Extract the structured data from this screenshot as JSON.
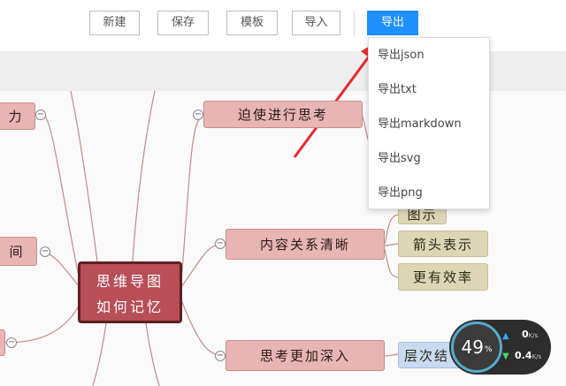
{
  "toolbar": {
    "new_label": "新建",
    "save_label": "保存",
    "template_label": "模板",
    "import_label": "导入",
    "export_label": "导出",
    "accent_color": "#1e90ff"
  },
  "export_menu": {
    "items": [
      "导出json",
      "导出txt",
      "导出markdown",
      "导出svg",
      "导出png"
    ]
  },
  "mindmap": {
    "center": {
      "line1": "思维导图",
      "line2": "如何记忆"
    },
    "left_nodes": [
      "力",
      "间"
    ],
    "right_nodes": [
      "迫使进行思考",
      "内容关系清晰",
      "思考更加深入"
    ],
    "sub_nodes": [
      "图示",
      "箭头表示",
      "更有效率",
      "层次结"
    ]
  },
  "net_widget": {
    "cpu_percent": "49",
    "percent_sign": "%",
    "upload": "0",
    "upload_unit": "K/s",
    "download": "0.4",
    "download_unit": "K/s"
  },
  "annotation": {
    "arrow_color": "#e8282b"
  }
}
